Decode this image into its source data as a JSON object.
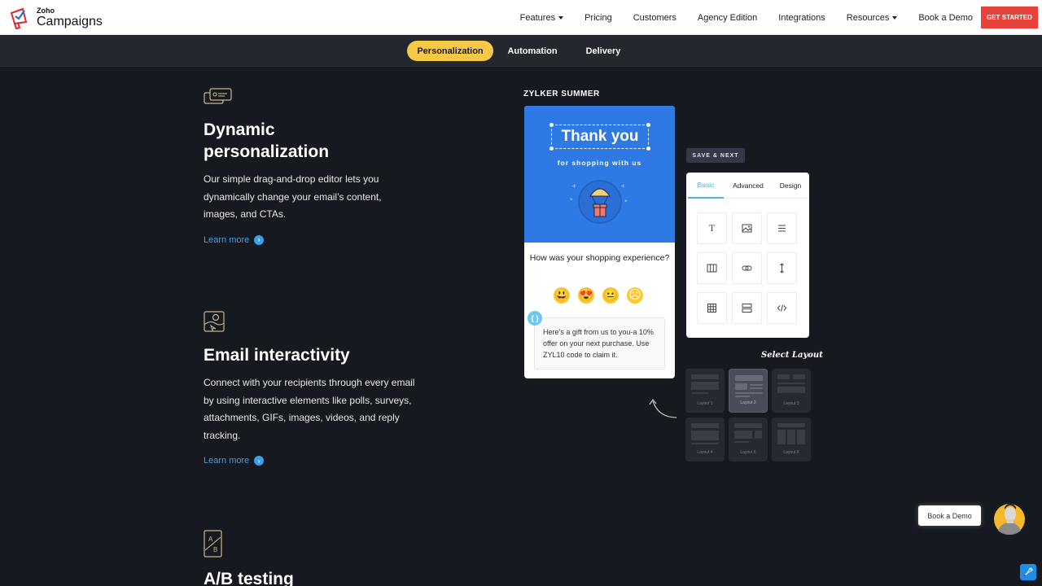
{
  "header": {
    "logo_zoho": "Zoho",
    "logo_product": "Campaigns",
    "nav": [
      {
        "label": "Features",
        "dropdown": true
      },
      {
        "label": "Pricing",
        "dropdown": false
      },
      {
        "label": "Customers",
        "dropdown": false
      },
      {
        "label": "Agency Edition",
        "dropdown": false
      },
      {
        "label": "Integrations",
        "dropdown": false
      },
      {
        "label": "Resources",
        "dropdown": true
      },
      {
        "label": "Book a Demo",
        "dropdown": false
      }
    ],
    "cta_label": "GET STARTED",
    "cta_color": "#e8423b"
  },
  "subnav": {
    "tabs": [
      {
        "label": "Personalization",
        "active": true
      },
      {
        "label": "Automation",
        "active": false
      },
      {
        "label": "Delivery",
        "active": false
      }
    ],
    "active_color": "#f8c944"
  },
  "features": [
    {
      "icon": "id-card-icon",
      "title_line1": "Dynamic",
      "title_line2": "personalization",
      "description": "Our simple drag-and-drop editor lets you dynamically change your email’s content, images, and CTAs.",
      "link": "Learn more"
    },
    {
      "icon": "interactive-image-icon",
      "title_line1": "Email interactivity",
      "description": "Connect with your recipients through every email by using interactive elements like polls, surveys, attachments, GIFs, images, videos, and reply tracking.",
      "link": "Learn more"
    },
    {
      "icon": "ab-test-icon",
      "title_line1": "A/B testing"
    }
  ],
  "mockup": {
    "label": "ZYLKER SUMMER",
    "email_heading": "Thank you",
    "email_subheading": "for shopping with us",
    "question": "How was your shopping experience?",
    "emojis": [
      "😃",
      "😍",
      "😐",
      "☹"
    ],
    "gift_message": "Here’s a gift from us to you-a 10% offer on your next purchase. Use ZYL10 code to claim it.",
    "merge_tag_icon": "{ }",
    "save_next": "SAVE & NEXT",
    "panel_tabs": [
      {
        "label": "Basic",
        "active": true
      },
      {
        "label": "Advanced",
        "active": false
      },
      {
        "label": "Design",
        "active": false
      }
    ],
    "panel_blocks": [
      "text-block-icon",
      "image-block-icon",
      "list-block-icon",
      "columns-block-icon",
      "link-block-icon",
      "spacer-block-icon",
      "table-block-icon",
      "divider-block-icon",
      "code-block-icon"
    ],
    "text_block_glyph": "T",
    "select_layout": "Select Layout",
    "layouts": [
      {
        "label": "Layout 1",
        "selected": false
      },
      {
        "label": "Layout 2",
        "selected": true
      },
      {
        "label": "Layout 3",
        "selected": false
      },
      {
        "label": "Layout 4",
        "selected": false
      },
      {
        "label": "Layout 5",
        "selected": false
      },
      {
        "label": "Layout 6",
        "selected": false
      }
    ]
  },
  "floating": {
    "book_demo": "Book a Demo"
  }
}
